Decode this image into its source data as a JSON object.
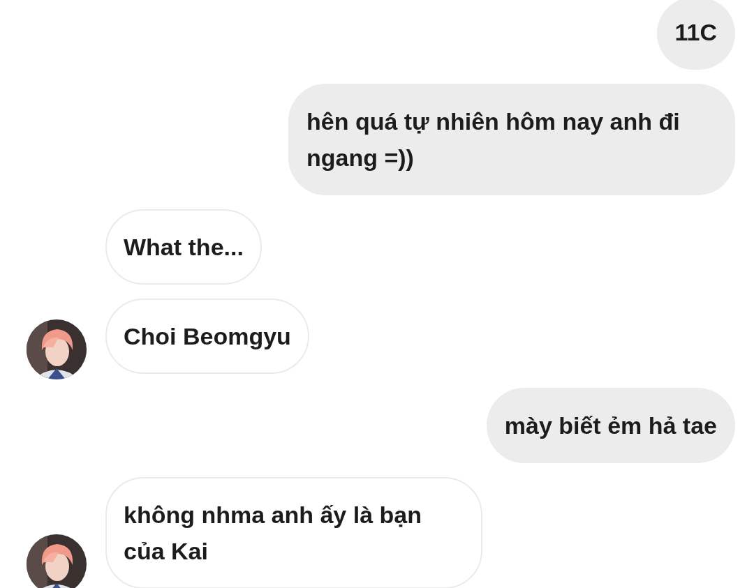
{
  "messages": [
    {
      "kind": "sent",
      "text": "11C"
    },
    {
      "kind": "sent",
      "text": "hên quá tự nhiên hôm nay anh đi ngang =))"
    },
    {
      "kind": "received",
      "text": "What the...",
      "avatar": false
    },
    {
      "kind": "received",
      "text": "Choi Beomgyu",
      "avatar": true
    },
    {
      "kind": "sent",
      "text": "mày biết ẻm hả tae"
    },
    {
      "kind": "received",
      "text": "không nhma anh ấy là bạn của Kai",
      "avatar": true
    }
  ]
}
